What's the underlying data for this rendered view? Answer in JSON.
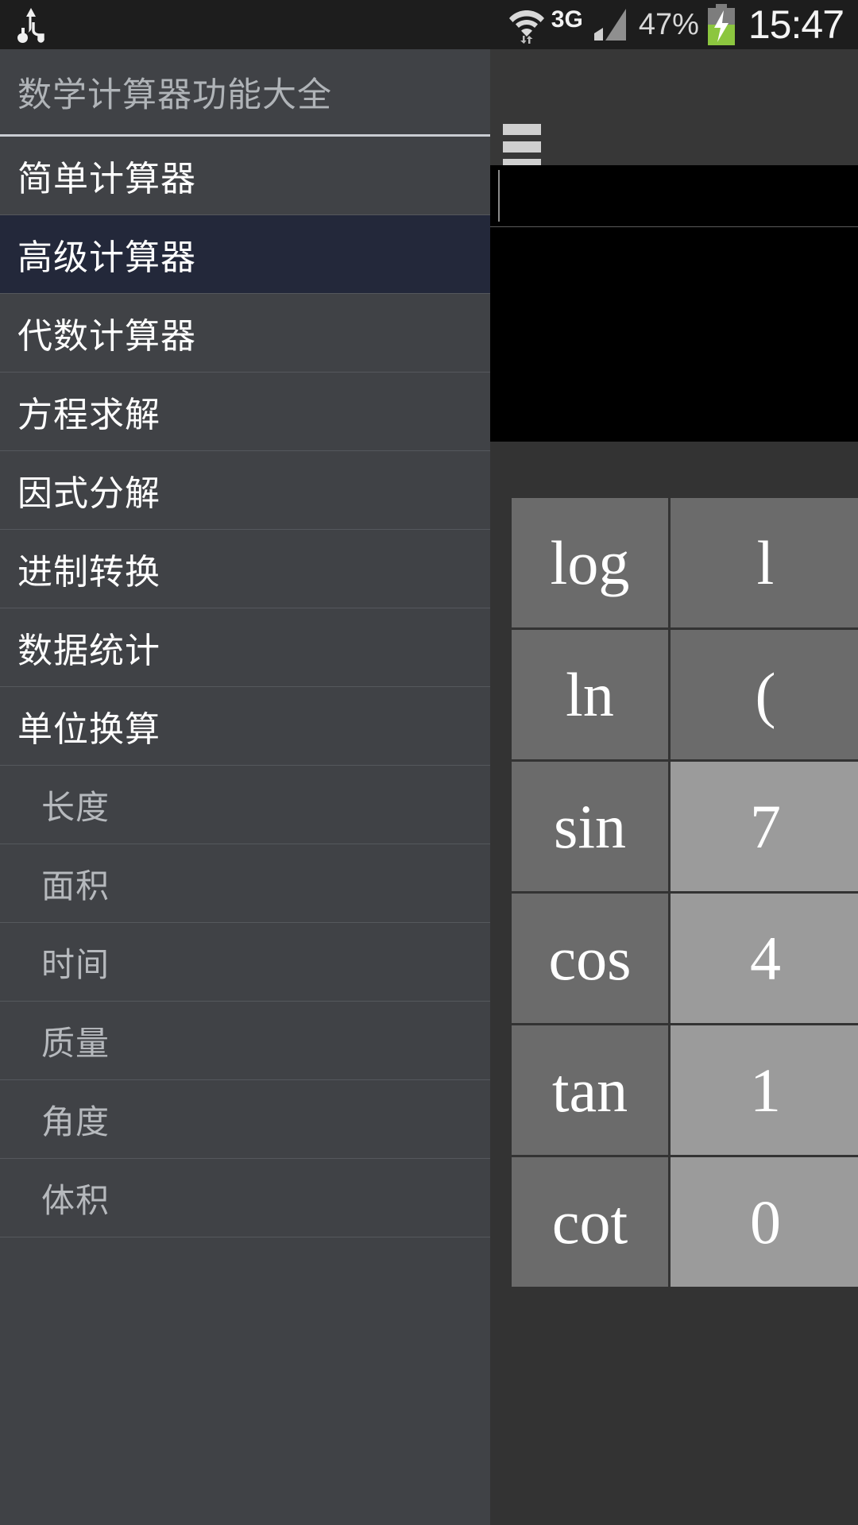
{
  "statusbar": {
    "usb_icon": "usb-icon",
    "wifi_icon": "wifi-icon",
    "network_type": "3G",
    "signal_icon": "signal-bars-icon",
    "battery_percent": "47%",
    "battery_icon": "battery-charging-icon",
    "clock": "15:47"
  },
  "actionbar": {
    "menu_icon": "hamburger-menu-icon"
  },
  "display": {
    "expression": "",
    "caret_icon": "text-caret"
  },
  "drawer": {
    "title": "数学计算器功能大全",
    "items": [
      {
        "label": "简单计算器",
        "sub": false,
        "selected": false
      },
      {
        "label": "高级计算器",
        "sub": false,
        "selected": true
      },
      {
        "label": "代数计算器",
        "sub": false,
        "selected": false
      },
      {
        "label": "方程求解",
        "sub": false,
        "selected": false
      },
      {
        "label": "因式分解",
        "sub": false,
        "selected": false
      },
      {
        "label": "进制转换",
        "sub": false,
        "selected": false
      },
      {
        "label": "数据统计",
        "sub": false,
        "selected": false
      },
      {
        "label": "单位换算",
        "sub": false,
        "selected": false
      },
      {
        "label": "长度",
        "sub": true,
        "selected": false
      },
      {
        "label": "面积",
        "sub": true,
        "selected": false
      },
      {
        "label": "时间",
        "sub": true,
        "selected": false
      },
      {
        "label": "质量",
        "sub": true,
        "selected": false
      },
      {
        "label": "角度",
        "sub": true,
        "selected": false
      },
      {
        "label": "体积",
        "sub": true,
        "selected": false
      }
    ]
  },
  "keypad": {
    "keys": [
      {
        "label": "log",
        "kind": "fn"
      },
      {
        "label": "l",
        "kind": "fn"
      },
      {
        "label": "ln",
        "kind": "fn"
      },
      {
        "label": "(",
        "kind": "fn"
      },
      {
        "label": "sin",
        "kind": "fn"
      },
      {
        "label": "7",
        "kind": "num"
      },
      {
        "label": "cos",
        "kind": "fn"
      },
      {
        "label": "4",
        "kind": "num"
      },
      {
        "label": "tan",
        "kind": "fn"
      },
      {
        "label": "1",
        "kind": "num"
      },
      {
        "label": "cot",
        "kind": "fn"
      },
      {
        "label": "0",
        "kind": "num"
      }
    ]
  },
  "colors": {
    "drawer_bg": "#404246",
    "drawer_selected": "#23283a",
    "keypad_fn": "#6b6b6b",
    "keypad_num": "#9b9b9b",
    "display_bg": "#000000",
    "accent_battery": "#8cc63f"
  }
}
